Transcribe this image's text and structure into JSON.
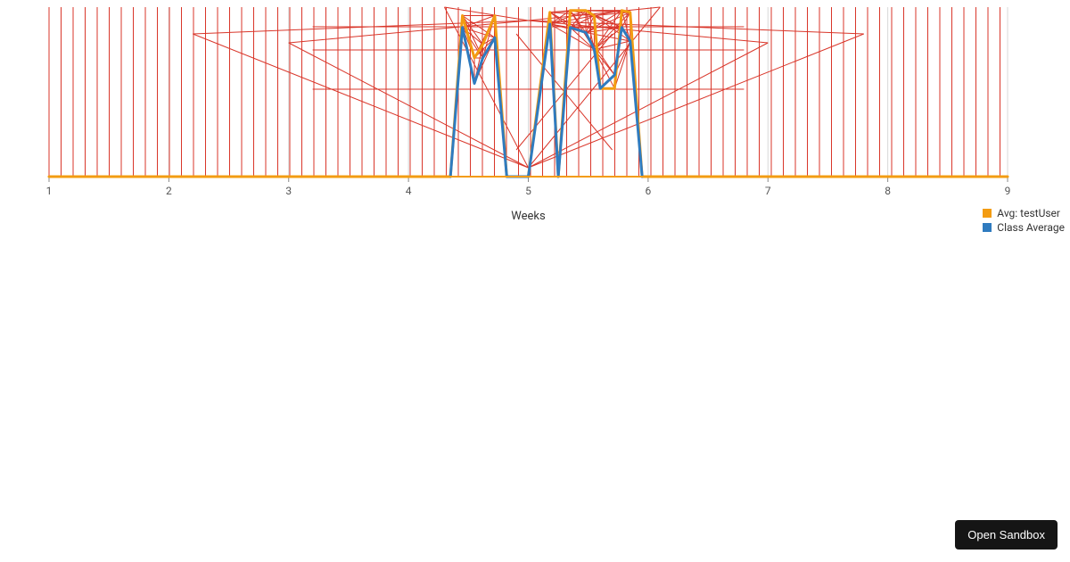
{
  "chart_data": {
    "type": "line",
    "xlabel": "Weeks",
    "ylabel": "",
    "x_ticks": [
      1,
      2,
      3,
      4,
      5,
      6,
      7,
      8,
      9
    ],
    "xlim": [
      1,
      9
    ],
    "ylim": [
      0,
      100
    ],
    "colors": {
      "avg_testUser": "#f39c12",
      "class_average": "#2f7bbf",
      "voronoi": "#d9362a"
    },
    "series": [
      {
        "name": "Avg: testUser",
        "color": "#f39c12",
        "x": [
          1.0,
          4.35,
          4.45,
          4.55,
          4.62,
          4.72,
          4.82,
          5.0,
          5.18,
          5.25,
          5.35,
          5.48,
          5.55,
          5.6,
          5.72,
          5.78,
          5.85,
          5.95,
          6.0,
          9.0
        ],
        "values": [
          0,
          0,
          95,
          70,
          78,
          95,
          0,
          0,
          97,
          0,
          98,
          98,
          95,
          52,
          52,
          98,
          97,
          0,
          0,
          0
        ]
      },
      {
        "name": "Class Average",
        "color": "#2f7bbf",
        "x": [
          4.35,
          4.45,
          4.55,
          4.62,
          4.72,
          4.82,
          5.0,
          5.18,
          5.25,
          5.35,
          5.48,
          5.55,
          5.6,
          5.72,
          5.78,
          5.85,
          5.95
        ],
        "values": [
          0,
          88,
          55,
          70,
          82,
          0,
          0,
          90,
          0,
          88,
          85,
          75,
          52,
          60,
          88,
          80,
          0
        ]
      }
    ],
    "legend": {
      "entries": [
        {
          "label": "Avg: testUser",
          "color": "#f39c12"
        },
        {
          "label": "Class Average",
          "color": "#2f7bbf"
        }
      ]
    }
  },
  "button": {
    "open_sandbox": "Open Sandbox"
  }
}
